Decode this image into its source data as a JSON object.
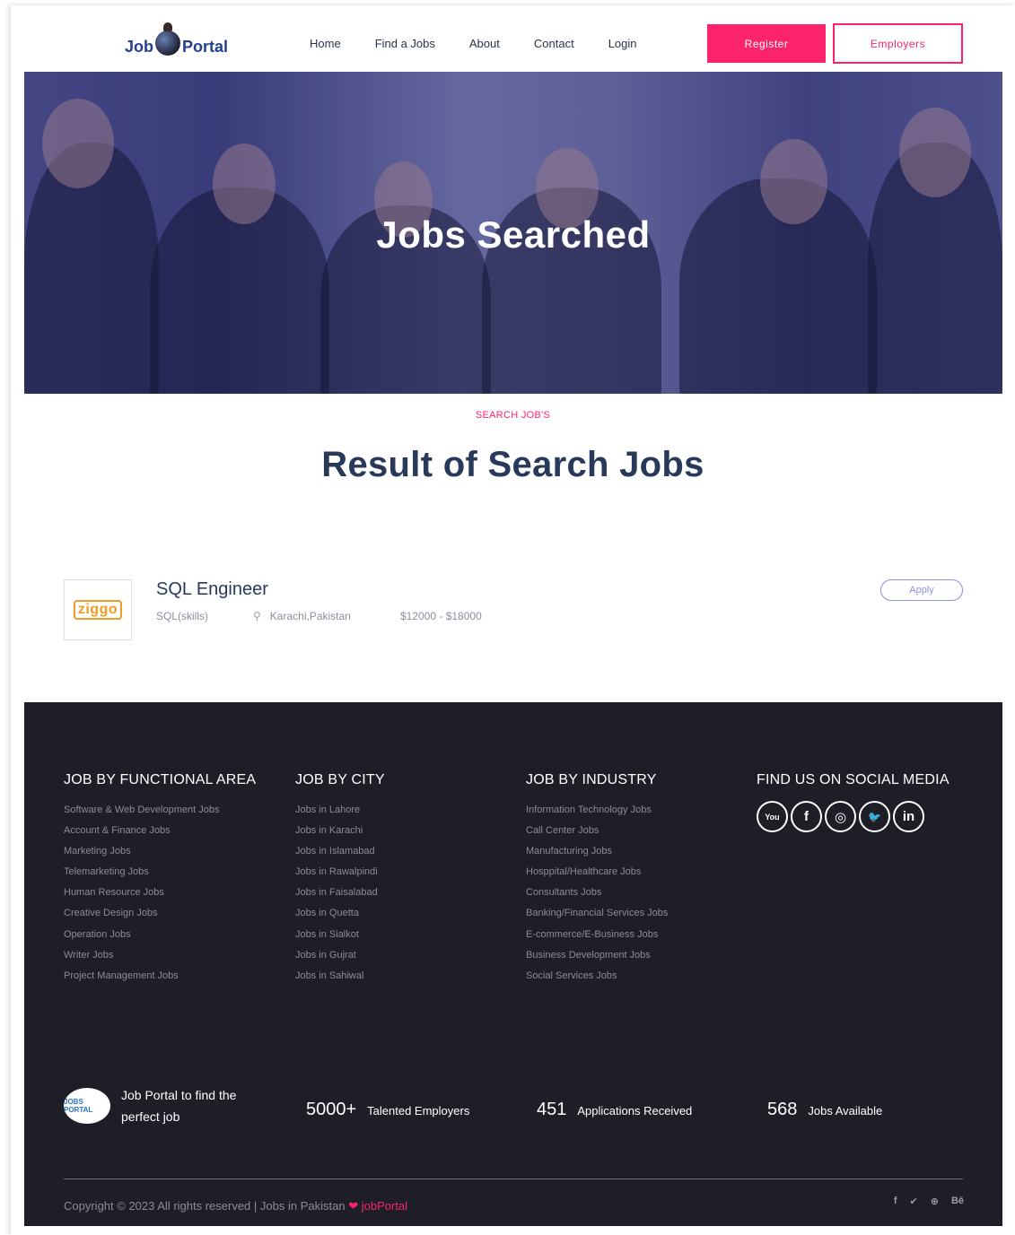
{
  "header": {
    "logo_left": "Job",
    "logo_right": "Portal",
    "nav": [
      "Home",
      "Find a Jobs",
      "About",
      "Contact",
      "Login"
    ],
    "register_label": "Register",
    "employers_label": "Employers"
  },
  "hero": {
    "title": "Jobs Searched"
  },
  "search": {
    "kicker": "SEARCH JOB'S",
    "title": "Result of Search Jobs"
  },
  "job": {
    "company_logo_text": "ziggo",
    "title": "SQL Engineer",
    "skill": "SQL(skills)",
    "location": "Karachi,Pakistan",
    "salary": "$12000 - $18000",
    "apply_label": "Apply"
  },
  "footer": {
    "functional": {
      "heading": "JOB BY FUNCTIONAL AREA",
      "items": [
        "Software & Web Development Jobs",
        "Account & Finance Jobs",
        "Marketing Jobs",
        "Telemarketing Jobs",
        "Human Resource Jobs",
        "Creative Design Jobs",
        "Operation Jobs",
        "Writer Jobs",
        "Project Management Jobs"
      ]
    },
    "city": {
      "heading": "JOB BY CITY",
      "items": [
        "Jobs in Lahore",
        "Jobs in Karachi",
        "Jobs in Islamabad",
        "Jobs in Rawalpindi",
        "Jobs in Faisalabad",
        "Jobs in Quetta",
        "Jobs in Sialkot",
        "Jobs in Gujrat",
        "Jobs in Sahiwal"
      ]
    },
    "industry": {
      "heading": "JOB BY INDUSTRY",
      "items": [
        "Information Technology Jobs",
        "Call Center Jobs",
        "Manufacturing Jobs",
        "Hosppital/Healthcare Jobs",
        "Consultants Jobs",
        "Banking/Financial Services Jobs",
        "E-commerce/E-Business Jobs",
        "Business Development Jobs",
        "Social Services Jobs"
      ]
    },
    "social": {
      "heading": "FIND US ON SOCIAL MEDIA",
      "icons": [
        "youtube-icon",
        "facebook-icon",
        "instagram-icon",
        "twitter-icon",
        "linkedin-icon"
      ],
      "glyphs": [
        "You",
        "f",
        "◎",
        "🐦",
        "in"
      ]
    },
    "logo_text": "JOBS PORTAL",
    "tagline": "Job Portal to find the perfect job",
    "stats": [
      {
        "num": "5000+",
        "label": "Talented Employers"
      },
      {
        "num": "451",
        "label": "Applications Received"
      },
      {
        "num": "568",
        "label": "Jobs Available"
      }
    ],
    "copyright_text": "Copyright © 2023 All rights reserved | Jobs in Pakistan",
    "copyright_brand": "jobPortal",
    "mini_social": [
      "f",
      "✔",
      "⊕",
      "Bē"
    ]
  },
  "colors": {
    "accent": "#fb246a",
    "navy": "#28395a",
    "footer_bg": "#1e1e26",
    "hero_overlay": "#282e82"
  }
}
